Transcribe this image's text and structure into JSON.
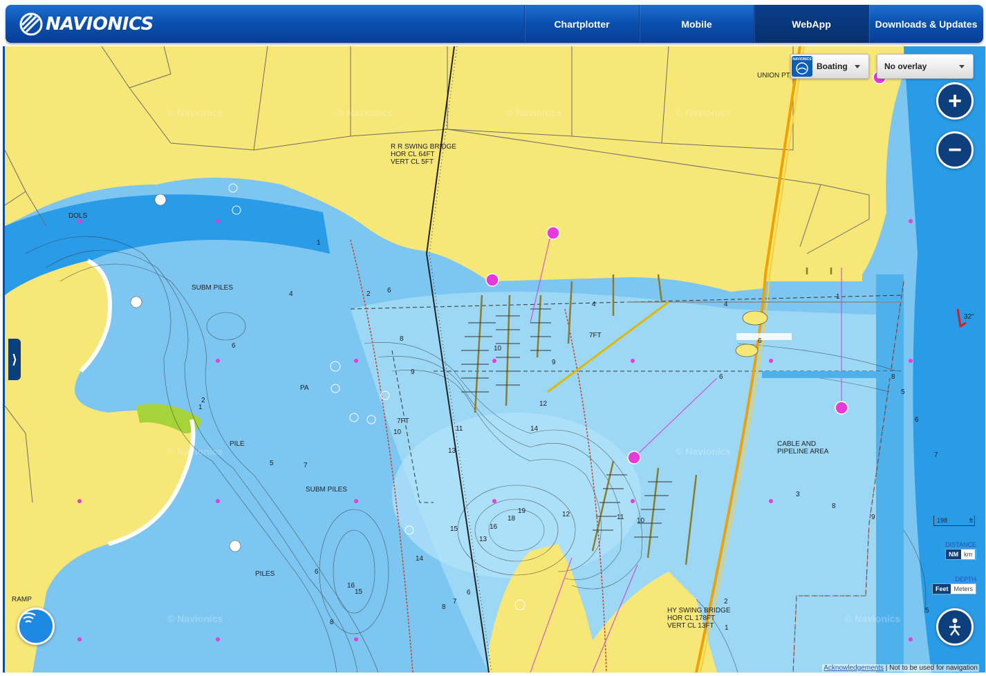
{
  "header": {
    "brand": "NAVIONICS",
    "nav": [
      "Chartplotter",
      "Mobile",
      "WebApp",
      "Downloads & Updates"
    ],
    "active_nav": "WebApp"
  },
  "controls": {
    "mode_badge": "NAVIONICS",
    "mode_label": "Boating",
    "overlay_label": "No overlay",
    "zoom_in": "+",
    "zoom_out": "−",
    "side_tab": "⟩",
    "scale_value": "198",
    "scale_unit": "ft",
    "distance_label": "DISTANCE",
    "distance_units": [
      "NM",
      "km"
    ],
    "depth_label": "DEPTH",
    "depth_units": [
      "Feet",
      "Meters"
    ]
  },
  "footer": {
    "link": "Acknowledgements",
    "separator": " | ",
    "notice": "Not to be used for navigation"
  },
  "map": {
    "watermark": "© Navionics",
    "labels": {
      "union_pt": "UNION PT.",
      "rr_bridge": "R R SWING BRIDGE\nHOR CL 64FT\nVERT CL 5FT",
      "dols": "DOLS",
      "subm_piles_1": "SUBM PILES",
      "subm_piles_2": "SUBM PILES",
      "pile": "PILE",
      "piles": "PILES",
      "pa": "PA",
      "ramp": "RAMP",
      "cable": "CABLE AND\nPIPELINE AREA",
      "hy_bridge": "HY SWING BRIDGE\nHOR CL 178FT\nVERT CL 13FT",
      "seven_ft_1": "7FT",
      "seven_ft_2": "7FT",
      "bearing": "32\""
    },
    "soundings": [
      "1",
      "2",
      "4",
      "6",
      "8",
      "6",
      "9",
      "2",
      "1",
      "5",
      "7",
      "6",
      "8",
      "10",
      "11",
      "13",
      "14",
      "12",
      "10",
      "9",
      "4",
      "6",
      "16",
      "15",
      "14",
      "8",
      "7",
      "6",
      "18",
      "19",
      "12",
      "16",
      "15",
      "13",
      "11",
      "10",
      "6",
      "3",
      "8",
      "5",
      "6",
      "7",
      "9",
      "8",
      "1",
      "2",
      "5",
      "1",
      "4"
    ]
  }
}
